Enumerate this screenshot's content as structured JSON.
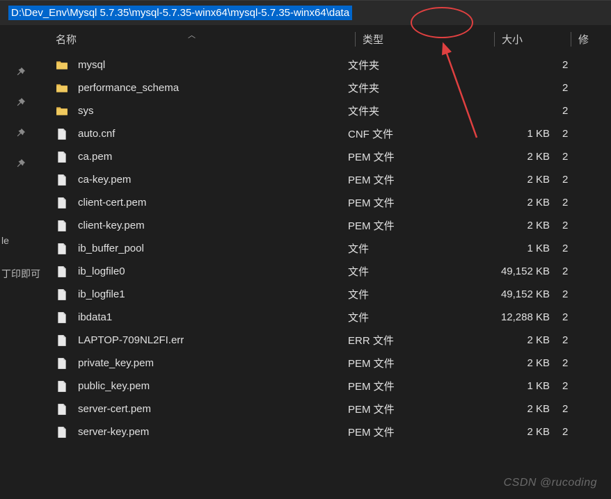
{
  "addressBar": {
    "path": "D:\\Dev_Env\\Mysql 5.7.35\\mysql-5.7.35-winx64\\mysql-5.7.35-winx64\\data"
  },
  "columns": {
    "name": "名称",
    "type": "类型",
    "size": "大小",
    "modified": "修"
  },
  "leftPanel": {
    "label1": "le",
    "label2": "丁印即可"
  },
  "files": [
    {
      "icon": "folder",
      "name": "mysql",
      "type": "文件夹",
      "size": "",
      "mod": "2"
    },
    {
      "icon": "folder",
      "name": "performance_schema",
      "type": "文件夹",
      "size": "",
      "mod": "2"
    },
    {
      "icon": "folder",
      "name": "sys",
      "type": "文件夹",
      "size": "",
      "mod": "2"
    },
    {
      "icon": "file",
      "name": "auto.cnf",
      "type": "CNF 文件",
      "size": "1 KB",
      "mod": "2"
    },
    {
      "icon": "file",
      "name": "ca.pem",
      "type": "PEM 文件",
      "size": "2 KB",
      "mod": "2"
    },
    {
      "icon": "file",
      "name": "ca-key.pem",
      "type": "PEM 文件",
      "size": "2 KB",
      "mod": "2"
    },
    {
      "icon": "file",
      "name": "client-cert.pem",
      "type": "PEM 文件",
      "size": "2 KB",
      "mod": "2"
    },
    {
      "icon": "file",
      "name": "client-key.pem",
      "type": "PEM 文件",
      "size": "2 KB",
      "mod": "2"
    },
    {
      "icon": "file",
      "name": "ib_buffer_pool",
      "type": "文件",
      "size": "1 KB",
      "mod": "2"
    },
    {
      "icon": "file",
      "name": "ib_logfile0",
      "type": "文件",
      "size": "49,152 KB",
      "mod": "2"
    },
    {
      "icon": "file",
      "name": "ib_logfile1",
      "type": "文件",
      "size": "49,152 KB",
      "mod": "2"
    },
    {
      "icon": "file",
      "name": "ibdata1",
      "type": "文件",
      "size": "12,288 KB",
      "mod": "2"
    },
    {
      "icon": "file",
      "name": "LAPTOP-709NL2FI.err",
      "type": "ERR 文件",
      "size": "2 KB",
      "mod": "2"
    },
    {
      "icon": "file",
      "name": "private_key.pem",
      "type": "PEM 文件",
      "size": "2 KB",
      "mod": "2"
    },
    {
      "icon": "file",
      "name": "public_key.pem",
      "type": "PEM 文件",
      "size": "1 KB",
      "mod": "2"
    },
    {
      "icon": "file",
      "name": "server-cert.pem",
      "type": "PEM 文件",
      "size": "2 KB",
      "mod": "2"
    },
    {
      "icon": "file",
      "name": "server-key.pem",
      "type": "PEM 文件",
      "size": "2 KB",
      "mod": "2"
    }
  ],
  "watermark": "CSDN @rucoding"
}
